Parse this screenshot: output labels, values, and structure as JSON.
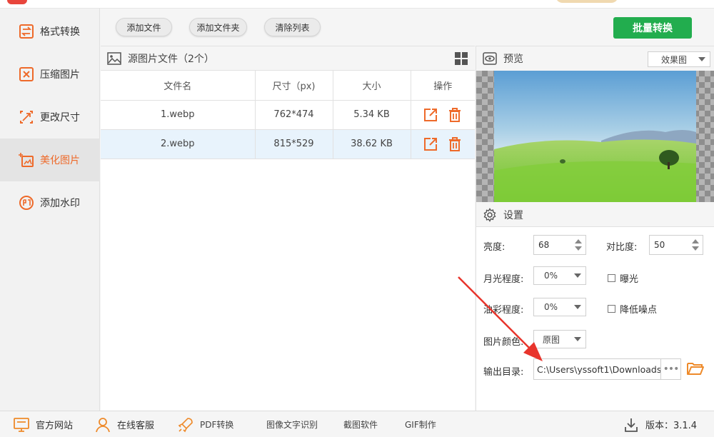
{
  "sidebar": {
    "items": [
      {
        "label": "格式转换",
        "icon": "format-convert-icon"
      },
      {
        "label": "压缩图片",
        "icon": "compress-icon"
      },
      {
        "label": "更改尺寸",
        "icon": "resize-icon"
      },
      {
        "label": "美化图片",
        "icon": "beautify-icon",
        "active": true
      },
      {
        "label": "添加水印",
        "icon": "watermark-icon"
      }
    ],
    "accent_color": "#ee6a2a"
  },
  "toolbar": {
    "add_file": "添加文件",
    "add_folder": "添加文件夹",
    "clear_list": "清除列表",
    "batch_convert": "批量转换",
    "batch_color": "#22ad4e"
  },
  "file_panel": {
    "title": "源图片文件（2个）",
    "columns": [
      "文件名",
      "尺寸（px)",
      "大小",
      "操作"
    ],
    "rows": [
      {
        "name": "1.webp",
        "size_px": "762*474",
        "file_size": "5.34 KB"
      },
      {
        "name": "2.webp",
        "size_px": "815*529",
        "file_size": "38.62 KB",
        "selected": true
      }
    ]
  },
  "preview": {
    "title": "预览",
    "mode": "效果图"
  },
  "settings": {
    "title": "设置",
    "brightness_label": "亮度:",
    "brightness_value": "68",
    "contrast_label": "对比度:",
    "contrast_value": "50",
    "moonlight_label": "月光程度:",
    "moonlight_value": "0%",
    "exposure_label": "曝光",
    "oil_label": "油彩程度:",
    "oil_value": "0%",
    "denoise_label": "降低噪点",
    "color_label": "图片颜色:",
    "color_value": "原图",
    "output_label": "输出目录:",
    "output_path": "C:\\Users\\yssoft1\\Downloads"
  },
  "bottom_bar": {
    "website": "官方网站",
    "support": "在线客服",
    "pdf": "PDF转换",
    "ocr": "图像文字识别",
    "screenshot": "截图软件",
    "gif": "GIF制作",
    "version": "版本：3.1.4"
  }
}
